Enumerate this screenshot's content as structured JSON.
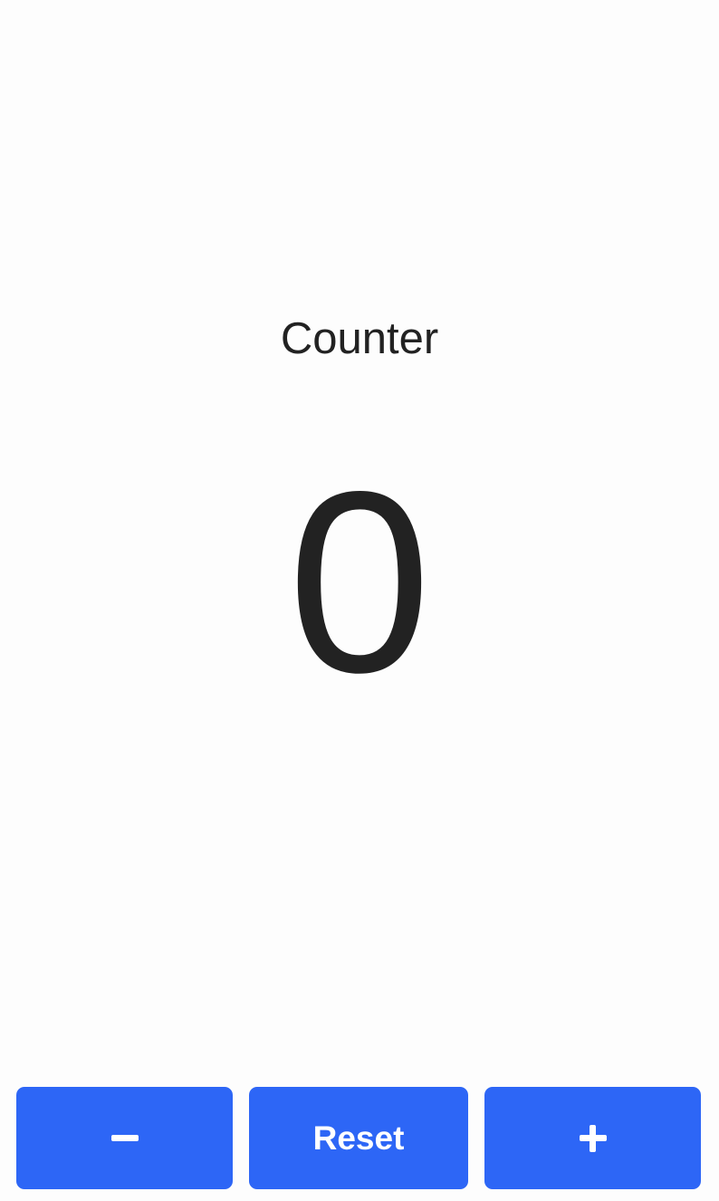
{
  "counter": {
    "title": "Counter",
    "value": "0"
  },
  "controls": {
    "decrement_icon": "minus-icon",
    "reset_label": "Reset",
    "increment_icon": "plus-icon"
  },
  "colors": {
    "button_bg": "#2d66f6",
    "text": "#222222",
    "background": "#fdfdfd"
  }
}
